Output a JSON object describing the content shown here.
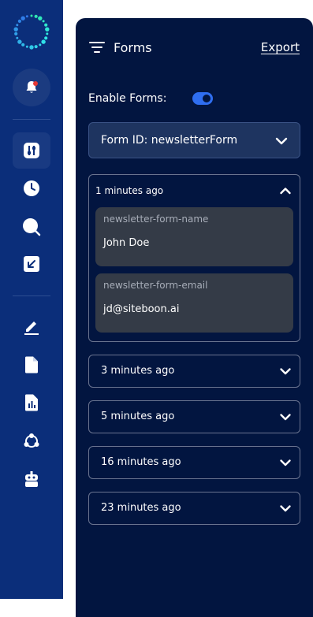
{
  "header": {
    "title": "Forms",
    "export_label": "Export"
  },
  "enable_forms": {
    "label": "Enable Forms:",
    "enabled": true
  },
  "form_select": {
    "label": "Form ID: newsletterForm"
  },
  "open_entry": {
    "time": "1 minutes ago",
    "fields": [
      {
        "name": "newsletter-form-name",
        "value": "John Doe"
      },
      {
        "name": "newsletter-form-email",
        "value": "jd@siteboon.ai"
      }
    ]
  },
  "entries": [
    {
      "time": "3 minutes ago"
    },
    {
      "time": "5 minutes ago"
    },
    {
      "time": "16 minutes ago"
    },
    {
      "time": "23 minutes ago"
    }
  ],
  "colors": {
    "rail": "#0b2e7a",
    "panel": "#021540",
    "accent": "#2f6ef0",
    "active_marker": "#2ad8b4",
    "notification_dot": "#e53935"
  },
  "rail_icons": [
    "sliders-icon",
    "clock-icon",
    "search-icon",
    "arrow-down-left-icon",
    "edit-icon",
    "file-icon",
    "report-icon",
    "network-icon",
    "robot-icon"
  ]
}
